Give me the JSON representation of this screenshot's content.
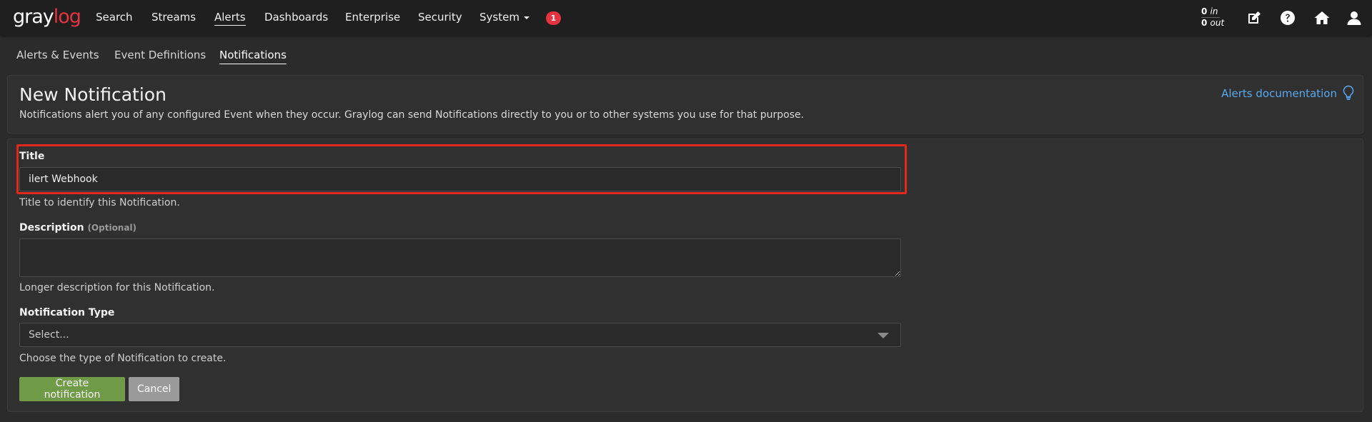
{
  "brand": {
    "logo_text_main": "gray",
    "logo_text_accent": "log"
  },
  "nav": {
    "items": [
      {
        "label": "Search"
      },
      {
        "label": "Streams"
      },
      {
        "label": "Alerts"
      },
      {
        "label": "Dashboards"
      },
      {
        "label": "Enterprise"
      },
      {
        "label": "Security"
      },
      {
        "label": "System"
      }
    ],
    "active": "Alerts",
    "notification_count": "1",
    "throughput": {
      "in_value": "0",
      "in_label": "in",
      "out_value": "0",
      "out_label": "out"
    },
    "icons": [
      "edit-icon",
      "help-icon",
      "home-icon",
      "user-icon"
    ]
  },
  "subnav": {
    "items": [
      {
        "label": "Alerts & Events"
      },
      {
        "label": "Event Definitions"
      },
      {
        "label": "Notifications"
      }
    ],
    "active": "Notifications"
  },
  "header": {
    "title": "New Notification",
    "description": "Notifications alert you of any configured Event when they occur. Graylog can send Notifications directly to you or to other systems you use for that purpose.",
    "doc_link": "Alerts documentation"
  },
  "form": {
    "title_label": "Title",
    "title_value": "ilert Webhook",
    "title_help": "Title to identify this Notification.",
    "description_label": "Description",
    "description_optional": "(Optional)",
    "description_value": "",
    "description_help": "Longer description for this Notification.",
    "type_label": "Notification Type",
    "type_placeholder": "Select...",
    "type_help": "Choose the type of Notification to create.",
    "submit_label": "Create notification",
    "cancel_label": "Cancel"
  },
  "colors": {
    "accent_red": "#e5343f",
    "link_blue": "#5aa9f0",
    "primary_green": "#6f9a46",
    "highlight_red": "#e3281b"
  }
}
